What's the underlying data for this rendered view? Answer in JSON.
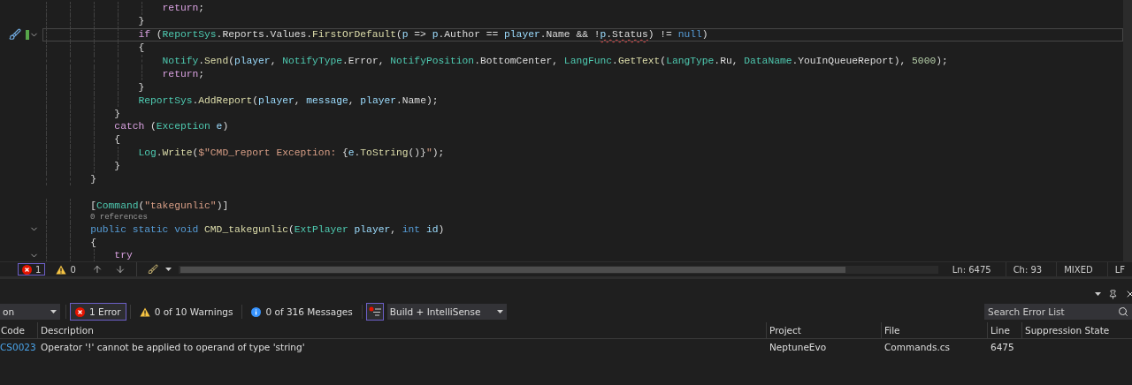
{
  "editor": {
    "lines": [
      {
        "current": false,
        "changed": false,
        "quick_action": false,
        "fold_marker": false,
        "kind": "code",
        "tokens": [
          {
            "text": "                    return",
            "kind": "control"
          },
          {
            "text": ";",
            "kind": "plain"
          }
        ]
      },
      {
        "current": false,
        "changed": false,
        "quick_action": false,
        "fold_marker": false,
        "kind": "code",
        "tokens": [
          {
            "text": "                }",
            "kind": "plain"
          }
        ]
      },
      {
        "current": true,
        "changed": true,
        "quick_action": true,
        "fold_marker": true,
        "kind": "code",
        "tokens": [
          {
            "text": "                if",
            "kind": "control"
          },
          {
            "text": " (",
            "kind": "plain"
          },
          {
            "text": "ReportSys",
            "kind": "type"
          },
          {
            "text": ".Reports.Values.",
            "kind": "plain"
          },
          {
            "text": "FirstOrDefault",
            "kind": "method"
          },
          {
            "text": "(",
            "kind": "plain"
          },
          {
            "text": "p",
            "kind": "variable"
          },
          {
            "text": " => ",
            "kind": "plain"
          },
          {
            "text": "p",
            "kind": "variable"
          },
          {
            "text": ".Author == ",
            "kind": "plain"
          },
          {
            "text": "player",
            "kind": "variable"
          },
          {
            "text": ".Name && !",
            "kind": "plain"
          },
          {
            "text": "p",
            "kind": "variable",
            "squiggle": true
          },
          {
            "text": ".Status",
            "kind": "plain",
            "squiggle": true
          },
          {
            "text": ") != ",
            "kind": "plain"
          },
          {
            "text": "null",
            "kind": "keyword"
          },
          {
            "text": ")",
            "kind": "plain"
          }
        ]
      },
      {
        "current": false,
        "changed": false,
        "quick_action": false,
        "fold_marker": false,
        "kind": "code",
        "tokens": [
          {
            "text": "                {",
            "kind": "plain"
          }
        ]
      },
      {
        "current": false,
        "changed": false,
        "quick_action": false,
        "fold_marker": false,
        "kind": "code",
        "tokens": [
          {
            "text": "                    Notify",
            "kind": "type"
          },
          {
            "text": ".",
            "kind": "plain"
          },
          {
            "text": "Send",
            "kind": "method"
          },
          {
            "text": "(",
            "kind": "plain"
          },
          {
            "text": "player",
            "kind": "variable"
          },
          {
            "text": ", ",
            "kind": "plain"
          },
          {
            "text": "NotifyType",
            "kind": "type"
          },
          {
            "text": ".Error, ",
            "kind": "plain"
          },
          {
            "text": "NotifyPosition",
            "kind": "type"
          },
          {
            "text": ".BottomCenter, ",
            "kind": "plain"
          },
          {
            "text": "LangFunc",
            "kind": "type"
          },
          {
            "text": ".",
            "kind": "plain"
          },
          {
            "text": "GetText",
            "kind": "method"
          },
          {
            "text": "(",
            "kind": "plain"
          },
          {
            "text": "LangType",
            "kind": "type"
          },
          {
            "text": ".Ru, ",
            "kind": "plain"
          },
          {
            "text": "DataName",
            "kind": "type"
          },
          {
            "text": ".YouInQueueReport), ",
            "kind": "plain"
          },
          {
            "text": "5000",
            "kind": "number"
          },
          {
            "text": ");",
            "kind": "plain"
          }
        ]
      },
      {
        "current": false,
        "changed": false,
        "quick_action": false,
        "fold_marker": false,
        "kind": "code",
        "tokens": [
          {
            "text": "                    return",
            "kind": "control"
          },
          {
            "text": ";",
            "kind": "plain"
          }
        ]
      },
      {
        "current": false,
        "changed": false,
        "quick_action": false,
        "fold_marker": false,
        "kind": "code",
        "tokens": [
          {
            "text": "                }",
            "kind": "plain"
          }
        ]
      },
      {
        "current": false,
        "changed": false,
        "quick_action": false,
        "fold_marker": false,
        "kind": "code",
        "tokens": [
          {
            "text": "                ReportSys",
            "kind": "type"
          },
          {
            "text": ".",
            "kind": "plain"
          },
          {
            "text": "AddReport",
            "kind": "method"
          },
          {
            "text": "(",
            "kind": "plain"
          },
          {
            "text": "player",
            "kind": "variable"
          },
          {
            "text": ", ",
            "kind": "plain"
          },
          {
            "text": "message",
            "kind": "variable"
          },
          {
            "text": ", ",
            "kind": "plain"
          },
          {
            "text": "player",
            "kind": "variable"
          },
          {
            "text": ".Name);",
            "kind": "plain"
          }
        ]
      },
      {
        "current": false,
        "changed": false,
        "quick_action": false,
        "fold_marker": false,
        "kind": "code",
        "tokens": [
          {
            "text": "            }",
            "kind": "plain"
          }
        ]
      },
      {
        "current": false,
        "changed": false,
        "quick_action": false,
        "fold_marker": false,
        "kind": "code",
        "tokens": [
          {
            "text": "            catch",
            "kind": "control"
          },
          {
            "text": " (",
            "kind": "plain"
          },
          {
            "text": "Exception ",
            "kind": "type"
          },
          {
            "text": "e",
            "kind": "variable"
          },
          {
            "text": ")",
            "kind": "plain"
          }
        ]
      },
      {
        "current": false,
        "changed": false,
        "quick_action": false,
        "fold_marker": false,
        "kind": "code",
        "tokens": [
          {
            "text": "            {",
            "kind": "plain"
          }
        ]
      },
      {
        "current": false,
        "changed": false,
        "quick_action": false,
        "fold_marker": false,
        "kind": "code",
        "tokens": [
          {
            "text": "                Log",
            "kind": "type"
          },
          {
            "text": ".",
            "kind": "plain"
          },
          {
            "text": "Write",
            "kind": "method"
          },
          {
            "text": "(",
            "kind": "plain"
          },
          {
            "text": "$\"CMD_report Exception: ",
            "kind": "string"
          },
          {
            "text": "{",
            "kind": "plain"
          },
          {
            "text": "e",
            "kind": "variable"
          },
          {
            "text": ".",
            "kind": "plain"
          },
          {
            "text": "ToString",
            "kind": "method"
          },
          {
            "text": "()}",
            "kind": "plain"
          },
          {
            "text": "\"",
            "kind": "string"
          },
          {
            "text": ");",
            "kind": "plain"
          }
        ]
      },
      {
        "current": false,
        "changed": false,
        "quick_action": false,
        "fold_marker": false,
        "kind": "code",
        "tokens": [
          {
            "text": "            }",
            "kind": "plain"
          }
        ]
      },
      {
        "current": false,
        "changed": false,
        "quick_action": false,
        "fold_marker": false,
        "kind": "code",
        "tokens": [
          {
            "text": "        }",
            "kind": "plain"
          }
        ]
      },
      {
        "current": false,
        "changed": false,
        "quick_action": false,
        "fold_marker": false,
        "kind": "code"
      },
      {
        "current": false,
        "changed": false,
        "quick_action": false,
        "fold_marker": false,
        "kind": "code",
        "tokens": [
          {
            "text": "        [",
            "kind": "plain"
          },
          {
            "text": "Command",
            "kind": "type"
          },
          {
            "text": "(",
            "kind": "plain"
          },
          {
            "text": "\"takegunlic\"",
            "kind": "string"
          },
          {
            "text": ")]",
            "kind": "plain"
          }
        ]
      },
      {
        "current": false,
        "changed": false,
        "quick_action": false,
        "fold_marker": false,
        "kind": "codelens",
        "text": "          0 references"
      },
      {
        "current": false,
        "changed": false,
        "quick_action": false,
        "fold_marker": true,
        "kind": "code",
        "tokens": [
          {
            "text": "        public static void ",
            "kind": "keyword"
          },
          {
            "text": "CMD_takegunlic",
            "kind": "method"
          },
          {
            "text": "(",
            "kind": "plain"
          },
          {
            "text": "ExtPlayer ",
            "kind": "type"
          },
          {
            "text": "player",
            "kind": "variable"
          },
          {
            "text": ", ",
            "kind": "plain"
          },
          {
            "text": "int ",
            "kind": "keyword"
          },
          {
            "text": "id",
            "kind": "variable"
          },
          {
            "text": ")",
            "kind": "plain"
          }
        ]
      },
      {
        "current": false,
        "changed": false,
        "quick_action": false,
        "fold_marker": false,
        "kind": "code",
        "tokens": [
          {
            "text": "        {",
            "kind": "plain"
          }
        ]
      },
      {
        "current": false,
        "changed": false,
        "quick_action": false,
        "fold_marker": true,
        "kind": "code",
        "tokens": [
          {
            "text": "            try",
            "kind": "control"
          }
        ]
      }
    ]
  },
  "status_bar": {
    "error_count": "1",
    "warning_count": "0",
    "line": "Ln: 6475",
    "column": "Ch: 93",
    "whitespace": "MIXED",
    "line_ending": "LF"
  },
  "error_list": {
    "scope_dropdown": "on",
    "filters": [
      {
        "kind": "error",
        "label": "1 Error",
        "selected": true
      },
      {
        "kind": "warning",
        "label": "0 of 10 Warnings",
        "selected": false
      },
      {
        "kind": "message",
        "label": "0 of 316 Messages",
        "selected": false
      }
    ],
    "filter_toggle": {
      "selected": true
    },
    "build_dropdown": "Build + IntelliSense",
    "search": {
      "placeholder": "Search Error List"
    },
    "columns": [
      "Code",
      "Description",
      "Project",
      "File",
      "Line",
      "Suppression State"
    ],
    "rows": [
      {
        "code": "CS0023",
        "description": "Operator '!' cannot be applied to operand of type 'string'",
        "project": "NeptuneEvo",
        "file": "Commands.cs",
        "line": "6475"
      }
    ]
  }
}
